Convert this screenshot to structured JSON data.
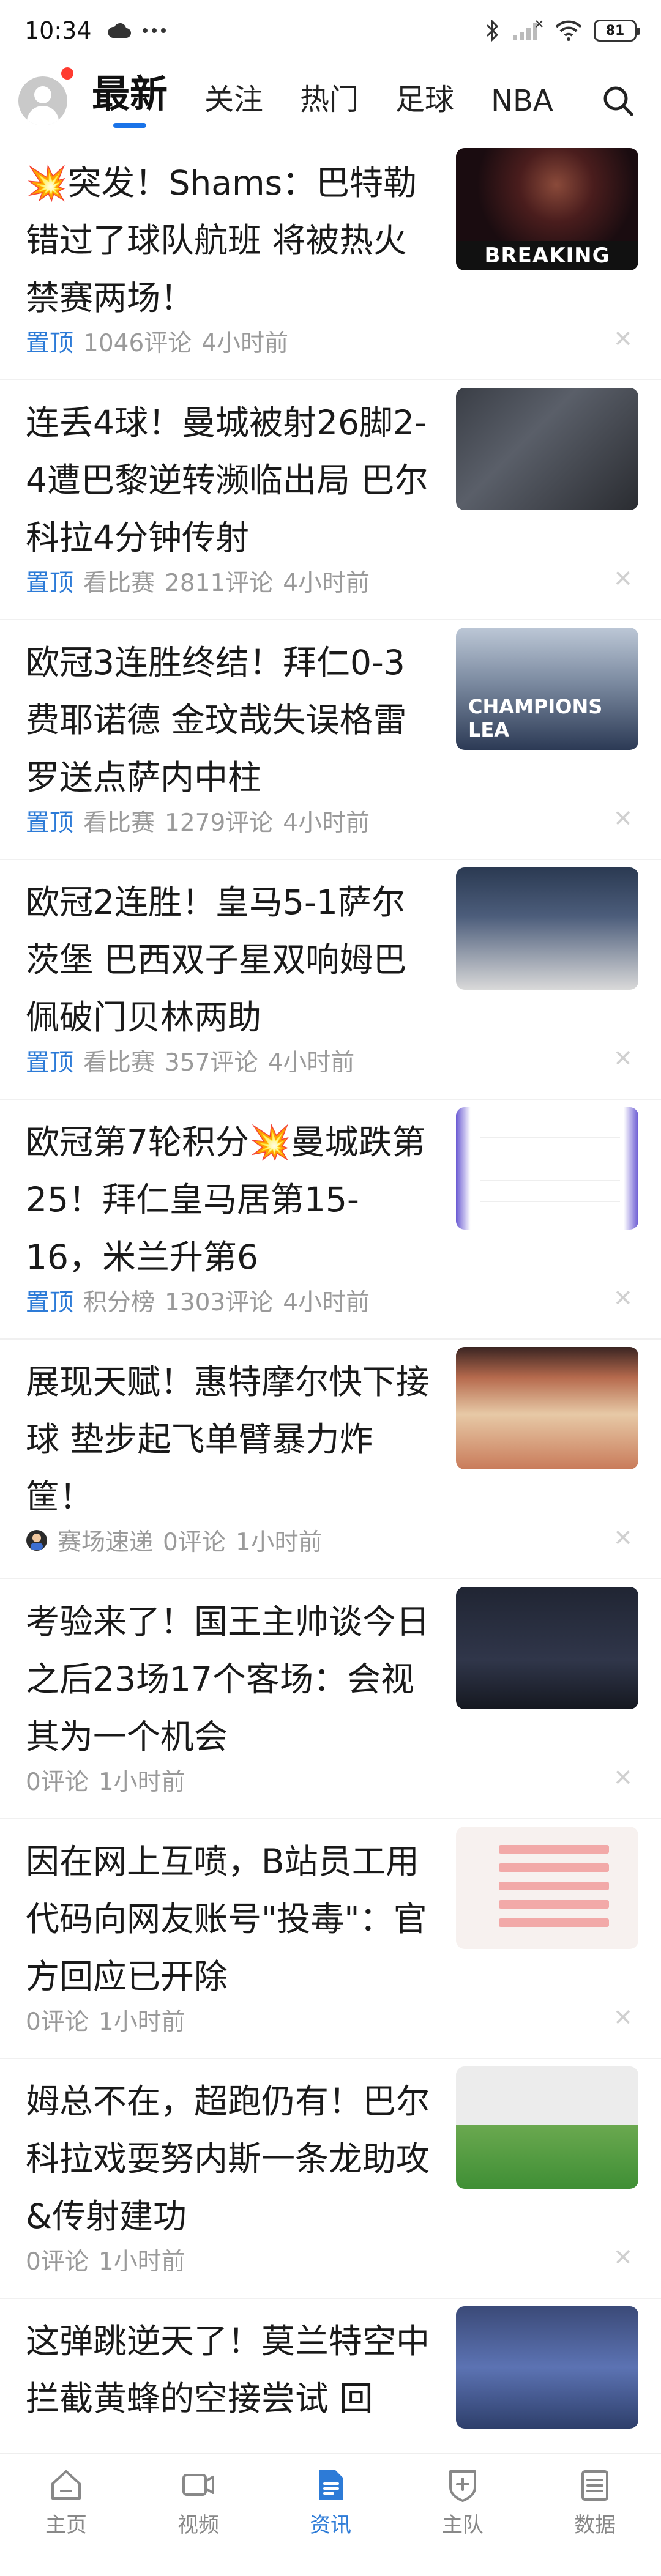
{
  "status_bar": {
    "time": "10:34",
    "icons_left": [
      "cloud-icon",
      "more-dots-icon"
    ],
    "icons_right": [
      "bluetooth-icon",
      "signal-icon",
      "wifi-icon"
    ],
    "battery": "81"
  },
  "header": {
    "avatar_icon": "user-avatar-icon",
    "tabs": [
      {
        "label": "最新",
        "active": true
      },
      {
        "label": "关注"
      },
      {
        "label": "热门"
      },
      {
        "label": "足球"
      },
      {
        "label": "NBA"
      }
    ],
    "accent_color": "#1a73e8"
  },
  "feed": [
    {
      "title": "💥突发！Shams：巴特勒错过了球队航班 将被热火禁赛两场！",
      "pin": "置顶",
      "tag": "",
      "comments": "1046评论",
      "time": "4小时前",
      "thumb_caption": "BREAKING NEWS"
    },
    {
      "title": "连丢4球！曼城被射26脚2-4遭巴黎逆转濒临出局 巴尔科拉4分钟传射",
      "pin": "置顶",
      "tag": "看比赛",
      "comments": "2811评论",
      "time": "4小时前"
    },
    {
      "title": "欧冠3连胜终结！拜仁0-3费耶诺德 金玟哉失误格雷罗送点萨内中柱",
      "pin": "置顶",
      "tag": "看比赛",
      "comments": "1279评论",
      "time": "4小时前",
      "thumb_caption": "CHAMPIONS LEA"
    },
    {
      "title": "欧冠2连胜！皇马5-1萨尔茨堡 巴西双子星双响姆巴佩破门贝林两助",
      "pin": "置顶",
      "tag": "看比赛",
      "comments": "357评论",
      "time": "4小时前"
    },
    {
      "title": "欧冠第7轮积分💥曼城跌第25！拜仁皇马居第15-16，米兰升第6",
      "pin": "置顶",
      "tag": "积分榜",
      "comments": "1303评论",
      "time": "4小时前"
    },
    {
      "title": "展现天赋！惠特摩尔快下接球 垫步起飞单臂暴力炸筐！",
      "pin": "",
      "tag": "赛场速递",
      "comments": "0评论",
      "time": "1小时前",
      "tag_icon": "source-avatar-icon"
    },
    {
      "title": "考验来了！国王主帅谈今日之后23场17个客场：会视其为一个机会",
      "pin": "",
      "tag": "",
      "comments": "0评论",
      "time": "1小时前"
    },
    {
      "title": "因在网上互喷，B站员工用代码向网友账号\"投毒\"：官方回应已开除",
      "pin": "",
      "tag": "",
      "comments": "0评论",
      "time": "1小时前"
    },
    {
      "title": "姆总不在，超跑仍有！巴尔科拉戏耍努内斯一条龙助攻&传射建功",
      "pin": "",
      "tag": "",
      "comments": "0评论",
      "time": "1小时前"
    },
    {
      "title": "这弹跳逆天了！莫兰特空中拦截黄蜂的空接尝试 回",
      "pin": "",
      "tag": "",
      "comments": "",
      "time": ""
    }
  ],
  "bottom_nav": [
    {
      "label": "主页",
      "icon": "home-icon"
    },
    {
      "label": "视频",
      "icon": "video-icon"
    },
    {
      "label": "资讯",
      "icon": "news-icon",
      "active": true
    },
    {
      "label": "主队",
      "icon": "team-shield-icon"
    },
    {
      "label": "数据",
      "icon": "data-list-icon"
    }
  ]
}
